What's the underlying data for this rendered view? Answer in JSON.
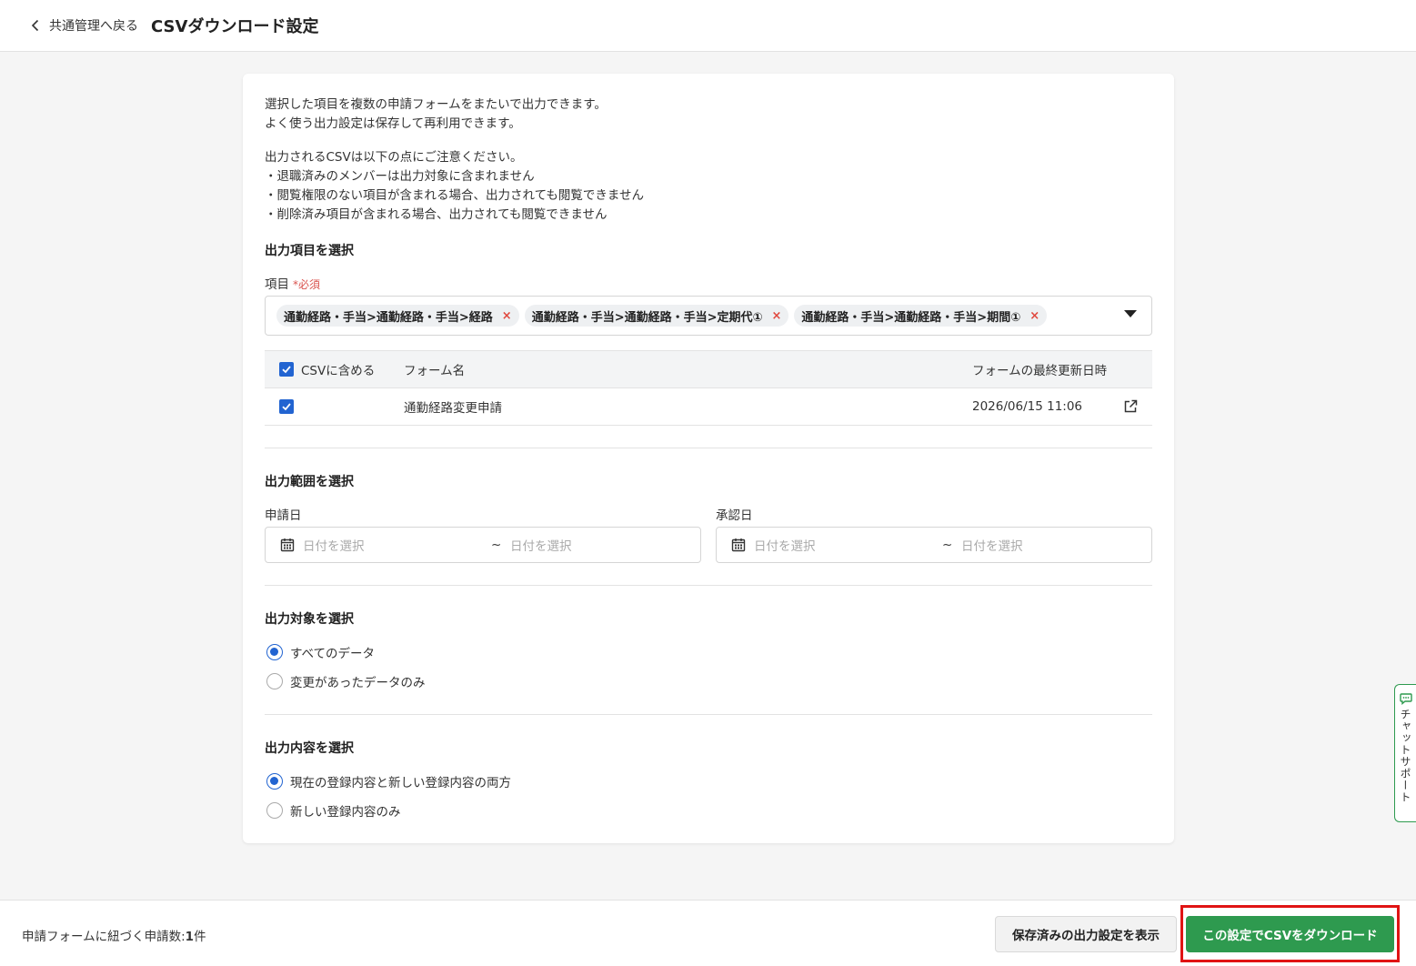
{
  "header": {
    "back_label": "共通管理へ戻る",
    "title": "CSVダウンロード設定"
  },
  "intro": {
    "lines": [
      "選択した項目を複数の申請フォームをまたいで出力できます。",
      "よく使う出力設定は保存して再利用できます。"
    ],
    "notes": [
      "出力されるCSVは以下の点にご注意ください。",
      "・退職済みのメンバーは出力対象に含まれません",
      "・閲覧権限のない項目が含まれる場合、出力されても閲覧できません",
      "・削除済み項目が含まれる場合、出力されても閲覧できません"
    ]
  },
  "items_section": {
    "title": "出力項目を選択",
    "field_label": "項目",
    "required_mark": "*必須",
    "tags": [
      "通勤経路・手当>通勤経路・手当>経路",
      "通勤経路・手当>通勤経路・手当>定期代①",
      "通勤経路・手当>通勤経路・手当>期間①"
    ],
    "tag_remove": "×",
    "table": {
      "headers": {
        "csv": "CSVに含める",
        "form_name": "フォーム名",
        "updated": "フォームの最終更新日時"
      },
      "rows": [
        {
          "form_name": "通勤経路変更申請",
          "updated": "2026/06/15 11:06"
        }
      ]
    }
  },
  "range_section": {
    "title": "出力範囲を選択",
    "apply_date_label": "申請日",
    "approve_date_label": "承認日",
    "placeholder": "日付を選択",
    "separator": "~"
  },
  "target_section": {
    "title": "出力対象を選択",
    "options": [
      "すべてのデータ",
      "変更があったデータのみ"
    ],
    "selected_index": 0
  },
  "content_section": {
    "title": "出力内容を選択",
    "options": [
      "現在の登録内容と新しい登録内容の両方",
      "新しい登録内容のみ"
    ],
    "selected_index": 0
  },
  "chat": {
    "label": "チャットサポート"
  },
  "footer": {
    "count_prefix": "申請フォームに紐づく申請数:",
    "count_value": "1",
    "count_suffix": "件",
    "saved_button": "保存済みの出力設定を表示",
    "download_button": "この設定でCSVをダウンロード"
  },
  "colors": {
    "primary_green": "#2e9a4f",
    "checkbox_blue": "#2264d1",
    "required_red": "#d9534f",
    "highlight_red": "#e01414"
  }
}
